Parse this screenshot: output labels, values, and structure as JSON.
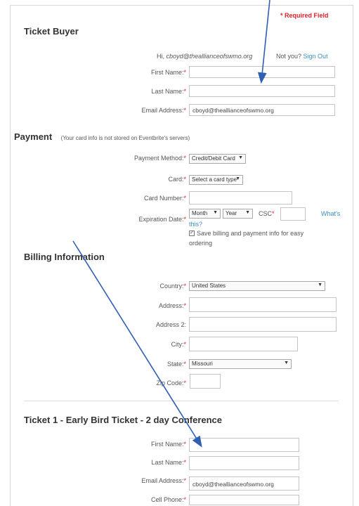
{
  "required_notice": "* Required Field",
  "ticket_buyer": {
    "title": "Ticket Buyer",
    "greeting_prefix": "Hi,",
    "email_display": "cboyd@theallianceofswmo.org",
    "not_you": "Not you?",
    "sign_out": "Sign Out",
    "first_name_label": "First Name:",
    "last_name_label": "Last Name:",
    "email_label": "Email Address:",
    "first_name_value": "",
    "last_name_value": "",
    "email_value": "cboyd@theallianceofswmo.org"
  },
  "payment": {
    "title": "Payment",
    "note": "(Your card info is not stored on Eventbrite's servers)",
    "method_label": "Payment Method:",
    "method_value": "Credit/Debit Card",
    "card_label": "Card:",
    "card_value": "Select a card type",
    "card_number_label": "Card Number:",
    "expiration_label": "Expiration Date:",
    "month_value": "Month",
    "year_value": "Year",
    "csc_label": "CSC",
    "whats_this_1": "What's",
    "whats_this_2": "this?",
    "save_label_1": "Save billing and payment info for easy",
    "save_label_2": "ordering"
  },
  "billing": {
    "title": "Billing Information",
    "country_label": "Country:",
    "country_value": "United States",
    "address_label": "Address:",
    "address2_label": "Address 2:",
    "city_label": "City:",
    "state_label": "State:",
    "state_value": "Missouri",
    "zip_label": "Zip Code:"
  },
  "ticket1": {
    "title": "Ticket 1 - Early Bird Ticket - 2 day Conference",
    "first_name_label": "First Name:",
    "last_name_label": "Last Name:",
    "email_label": "Email Address:",
    "email_value": "cboyd@theallianceofswmo.org",
    "cell_label": "Cell Phone:"
  },
  "colors": {
    "required": "#e0202a",
    "link": "#3b8ec7",
    "arrow": "#2f5fb3"
  }
}
